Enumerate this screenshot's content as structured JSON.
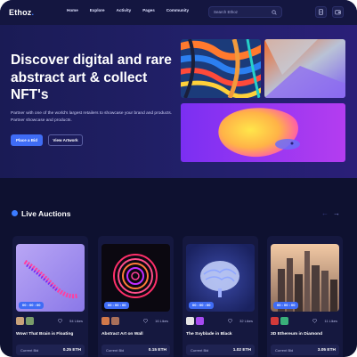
{
  "header": {
    "logo_main": "Ethoz",
    "logo_dot": ".",
    "nav": [
      "Home",
      "Explore",
      "Activity",
      "Pages",
      "Community"
    ],
    "search_placeholder": "Search Ethoz",
    "icons": [
      "search-icon",
      "document-icon",
      "wallet-icon"
    ]
  },
  "hero": {
    "title": "Discover digital and rare abstract art & collect NFT's",
    "description": "Partner with one of the world's largest retailers to showcase your brand and products. Partner showcase and products.",
    "primary_button": "Place a Bid",
    "secondary_button": "View Artwork"
  },
  "auctions": {
    "title": "Live Auctions",
    "cards": [
      {
        "timer": "00 : 00 : 00",
        "likes": "54 Likes",
        "title": "Wow! That Brain is Floating",
        "bid_label": "Current Bid",
        "bid_value": "0.25 ETH"
      },
      {
        "timer": "00 : 00 : 00",
        "likes": "16 Likes",
        "title": "Abstract Art on Wall",
        "bid_label": "Current Bid",
        "bid_value": "0.15 ETH"
      },
      {
        "timer": "00 : 00 : 00",
        "likes": "32 Likes",
        "title": "The Svyblade in Black",
        "bid_label": "Current Bid",
        "bid_value": "1.02 ETH"
      },
      {
        "timer": "00 : 00 : 00",
        "likes": "11 Likes",
        "title": "3D Ethereum in Diamond",
        "bid_label": "Current Bid",
        "bid_value": "3.05 ETH"
      }
    ]
  },
  "colors": {
    "background": "#0e1130",
    "accent": "#3f6cf5",
    "card": "#15183f"
  }
}
